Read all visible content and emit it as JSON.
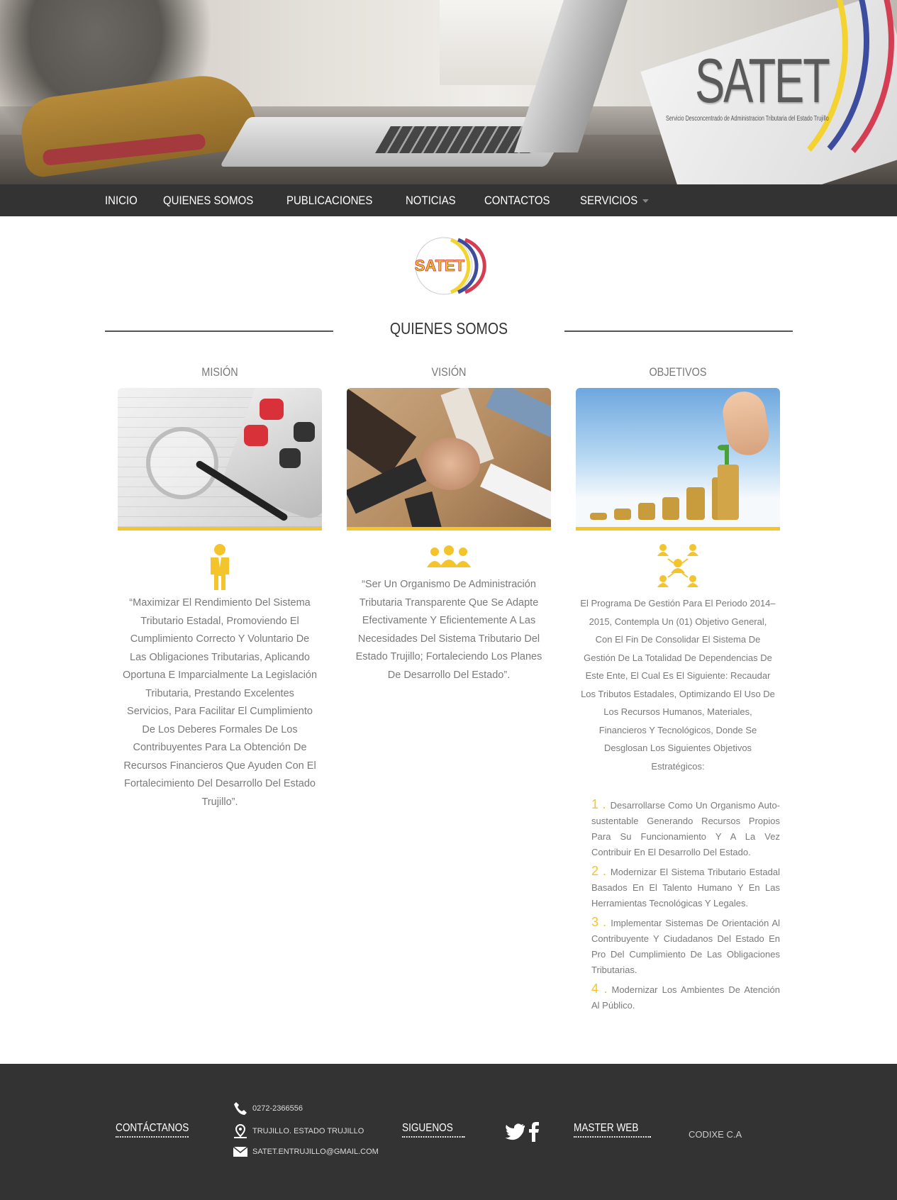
{
  "header": {
    "brand_name": "SATET",
    "brand_subtitle": "Servicio Desconcentrado de Administracion Tributaria del Estado Trujillo"
  },
  "nav": {
    "items": [
      {
        "label": "INICIO"
      },
      {
        "label": "QUIENES SOMOS"
      },
      {
        "label": "PUBLICACIONES"
      },
      {
        "label": "NOTICIAS"
      },
      {
        "label": "CONTACTOS"
      },
      {
        "label": "SERVICIOS"
      }
    ]
  },
  "logo": {
    "text": "SATET"
  },
  "section": {
    "title": "QUIENES SOMOS"
  },
  "columns": {
    "mision": {
      "title": "MISIÓN",
      "icon": "person-icon",
      "text": "“Maximizar El Rendimiento Del Sistema Tributario Estadal, Promoviendo El Cumplimiento Correcto Y Voluntario De Las Obligaciones Tributarias, Aplicando Oportuna E Imparcialmente La Legislación Tributaria, Prestando Excelentes Servicios, Para Facilitar El Cumplimiento De Los Deberes Formales De Los Contribuyentes Para La Obtención De Recursos Financieros Que Ayuden Con El Fortalecimiento Del Desarrollo Del Estado Trujillo”."
    },
    "vision": {
      "title": "VISIÓN",
      "icon": "team-icon",
      "text": "“Ser Un Organismo De Administración Tributaria Transparente Que Se Adapte Efectivamente Y Eficientemente A Las Necesidades Del Sistema Tributario Del Estado Trujillo; Fortaleciendo Los Planes De Desarrollo Del Estado”."
    },
    "objetivos": {
      "title": "OBJETIVOS",
      "icon": "network-icon",
      "text": "El Programa De Gestión Para El Periodo 2014–2015, Contempla Un (01) Objetivo General, Con El Fin De Consolidar El Sistema De Gestión De La Totalidad De Dependencias De Este Ente, El Cual Es El Siguiente: Recaudar Los Tributos Estadales, Optimizando El Uso De Los Recursos Humanos, Materiales, Financieros Y Tecnológicos, Donde Se Desglosan Los Siguientes Objetivos Estratégicos:",
      "list": [
        {
          "num": "1 .",
          "text": "Desarrollarse Como Un Organismo Auto-sustentable Generando Recursos Propios Para Su Funcionamiento Y A La Vez Contribuir En El Desarrollo Del Estado."
        },
        {
          "num": "2 .",
          "text": "Modernizar El Sistema Tributario Estadal Basados En El Talento Humano Y En Las Herramientas Tecnológicas Y Legales."
        },
        {
          "num": "3 .",
          "text": "Implementar Sistemas De Orientación Al Contribuyente Y Ciudadanos Del Estado En Pro Del Cumplimiento De Las Obligaciones Tributarias."
        },
        {
          "num": "4 .",
          "text": "Modernizar Los Ambientes De Atención Al Público."
        }
      ]
    }
  },
  "footer": {
    "contact_title": "CONTÁCTANOS",
    "phone": "0272-2366556",
    "address": "TRUJILLO. ESTADO TRUJILLO",
    "email": "SATET.ENTRUJILLO@GMAIL.COM",
    "follow_title": "SIGUENOS",
    "master_title": "MASTER WEB",
    "master_name": "CODIXE C.A"
  },
  "colors": {
    "accent": "#f4c42d",
    "nav_bg": "#333333",
    "footer_bg": "#333333"
  }
}
